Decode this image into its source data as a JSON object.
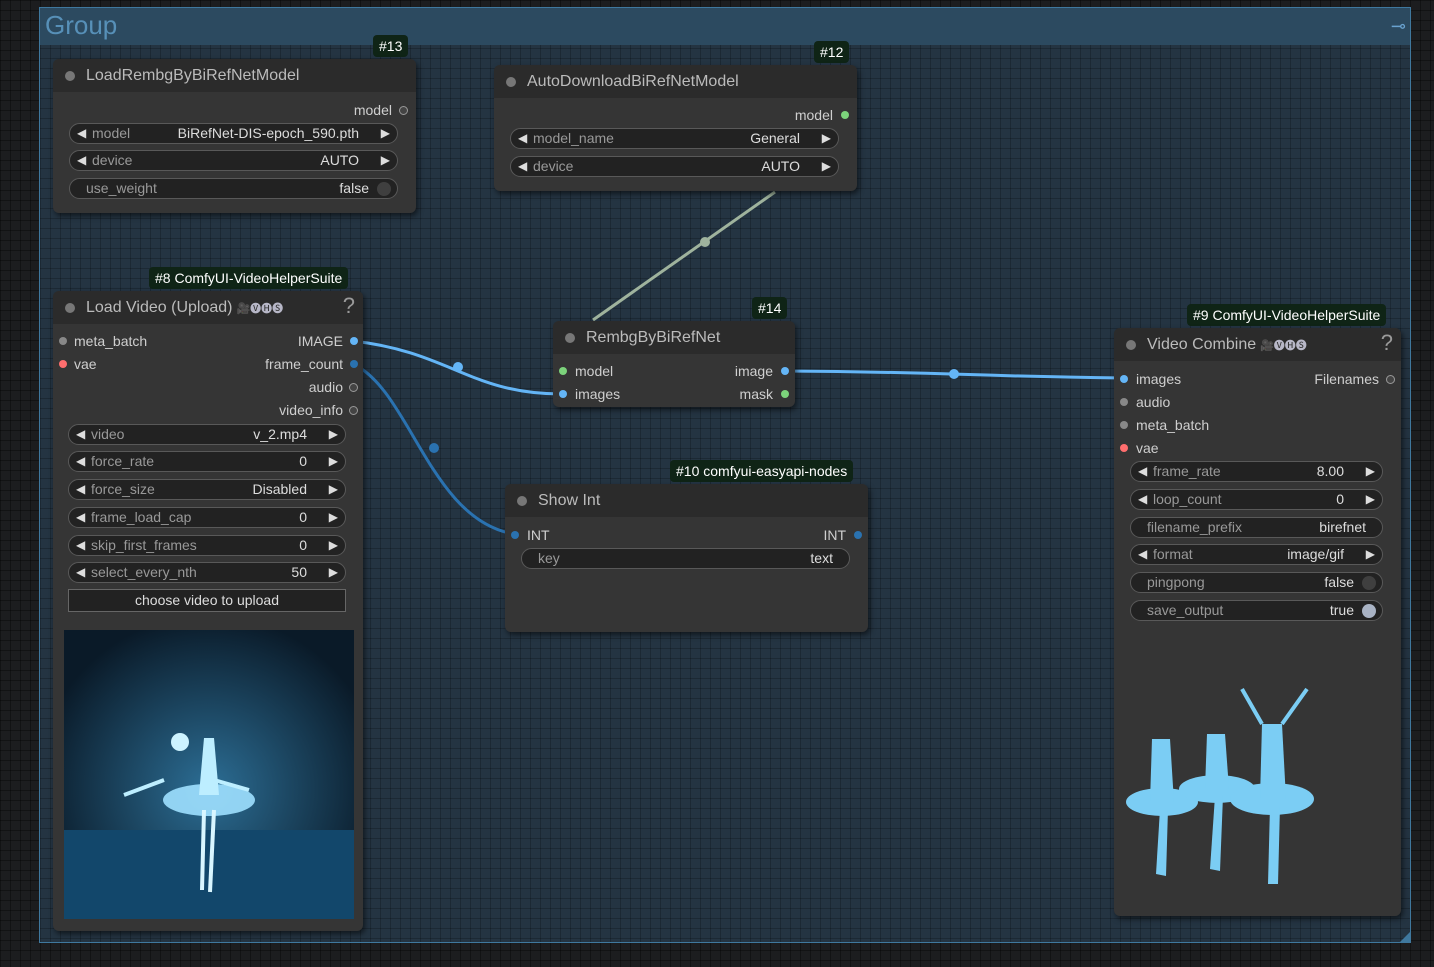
{
  "group": {
    "title": "Group"
  },
  "nodes": {
    "load_model": {
      "id": "#13",
      "title": "LoadRembgByBiRefNetModel",
      "outputs": [
        "model"
      ],
      "widgets": [
        {
          "label": "model",
          "value": "BiRefNet-DIS-epoch_590.pth"
        },
        {
          "label": "device",
          "value": "AUTO"
        },
        {
          "label": "use_weight",
          "value": "false"
        }
      ]
    },
    "auto_download": {
      "id": "#12",
      "title": "AutoDownloadBiRefNetModel",
      "outputs": [
        "model"
      ],
      "widgets": [
        {
          "label": "model_name",
          "value": "General"
        },
        {
          "label": "device",
          "value": "AUTO"
        }
      ]
    },
    "load_video": {
      "id": "#8 ComfyUI-VideoHelperSuite",
      "title": "Load Video (Upload)",
      "title_tag": "🎥🅥🅗🅢",
      "help": "?",
      "inputs": [
        "meta_batch",
        "vae"
      ],
      "outputs": [
        "IMAGE",
        "frame_count",
        "audio",
        "video_info"
      ],
      "widgets": [
        {
          "label": "video",
          "value": "v_2.mp4"
        },
        {
          "label": "force_rate",
          "value": "0"
        },
        {
          "label": "force_size",
          "value": "Disabled"
        },
        {
          "label": "frame_load_cap",
          "value": "0"
        },
        {
          "label": "skip_first_frames",
          "value": "0"
        },
        {
          "label": "select_every_nth",
          "value": "50"
        }
      ],
      "upload_label": "choose video to upload"
    },
    "rembg": {
      "id": "#14",
      "title": "RembgByBiRefNet",
      "inputs": [
        "model",
        "images"
      ],
      "outputs": [
        "image",
        "mask"
      ]
    },
    "show_int": {
      "id": "#10 comfyui-easyapi-nodes",
      "title": "Show Int",
      "inputs": [
        "INT"
      ],
      "outputs": [
        "INT"
      ],
      "widgets": [
        {
          "label": "key",
          "value": "text"
        }
      ]
    },
    "video_combine": {
      "id": "#9 ComfyUI-VideoHelperSuite",
      "title": "Video Combine",
      "title_tag": "🎥🅥🅗🅢",
      "help": "?",
      "inputs": [
        "images",
        "audio",
        "meta_batch",
        "vae"
      ],
      "outputs": [
        "Filenames"
      ],
      "widgets": [
        {
          "label": "frame_rate",
          "value": "8.00"
        },
        {
          "label": "loop_count",
          "value": "0"
        },
        {
          "label": "filename_prefix",
          "value": "birefnet"
        },
        {
          "label": "format",
          "value": "image/gif"
        },
        {
          "label": "pingpong",
          "value": "false"
        },
        {
          "label": "save_output",
          "value": "true"
        }
      ]
    }
  },
  "colors": {
    "image_link": "#64b5f6",
    "int_link": "#2a72b0",
    "model_link": "#9fb39d",
    "model_slot": "#7cd37b",
    "vae_slot": "#ff6e6e",
    "badge_bg": "#0f2416"
  }
}
